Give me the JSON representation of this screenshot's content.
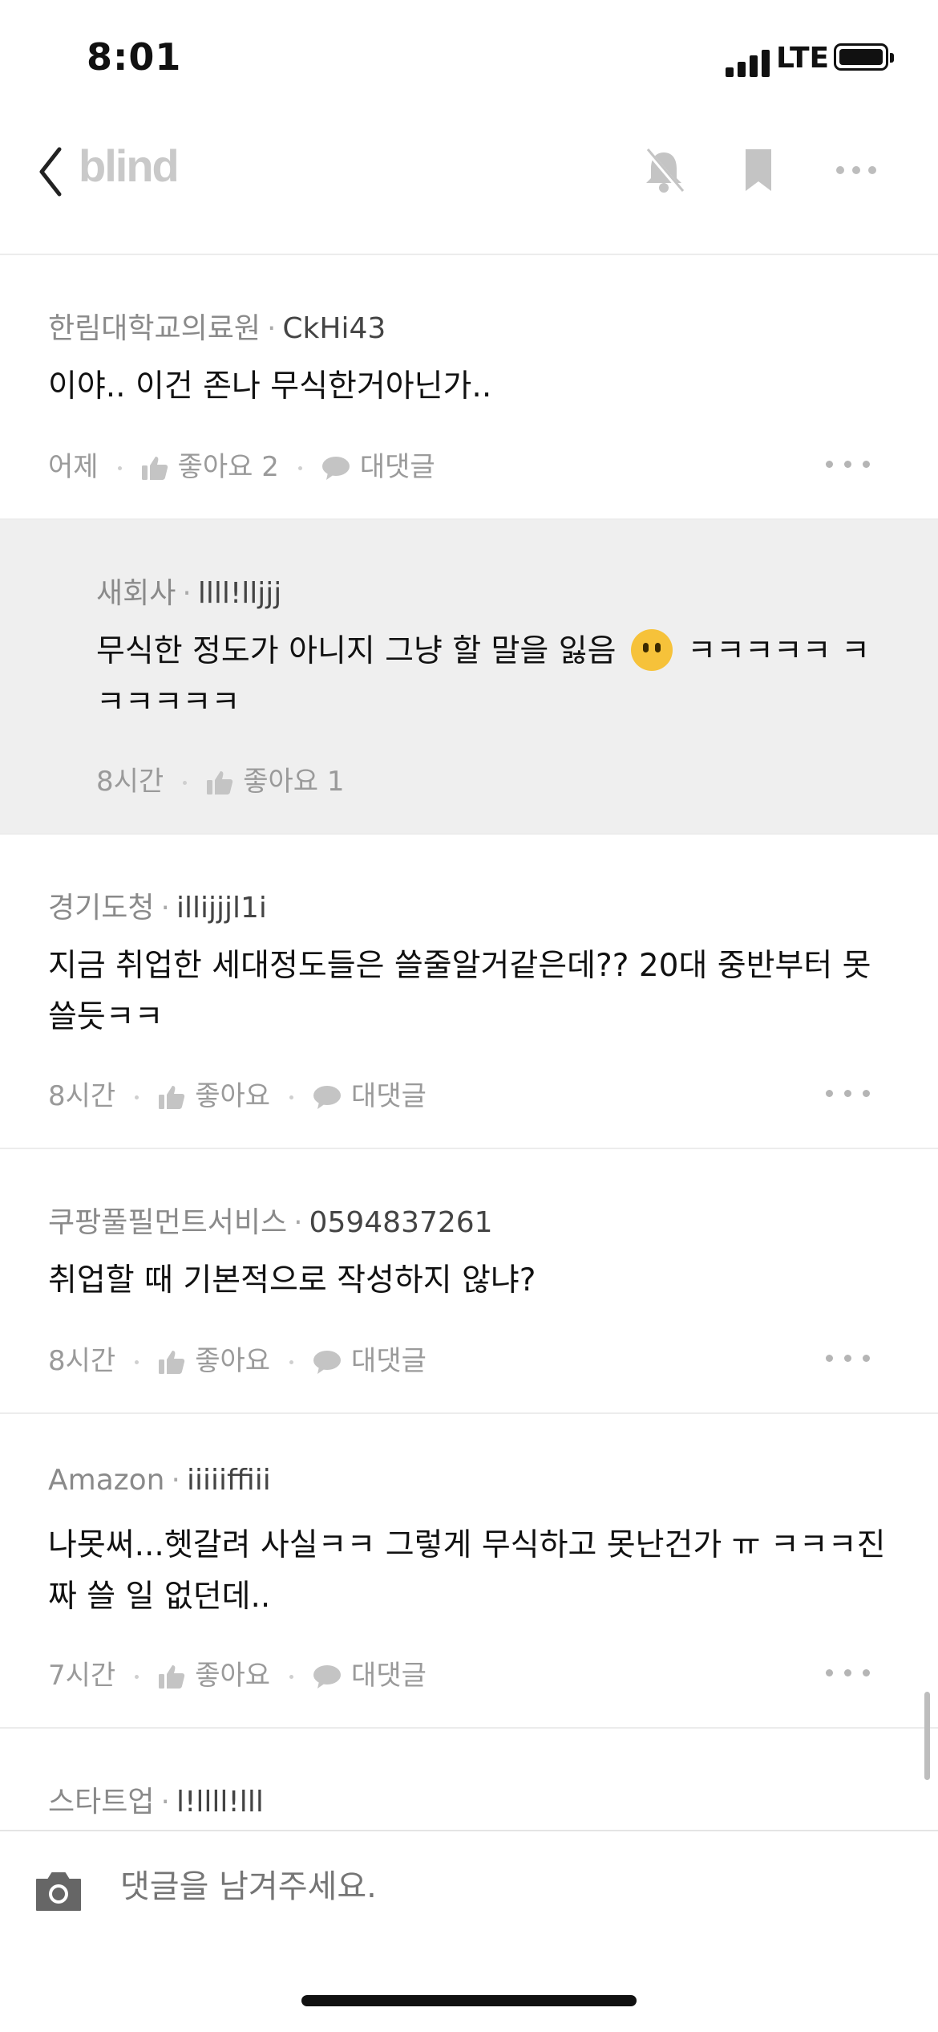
{
  "status_bar": {
    "time": "8:01",
    "network": "LTE"
  },
  "nav": {
    "brand": "blind",
    "icons": [
      "back-chevron-icon",
      "bell-off-icon",
      "bookmark-icon",
      "more-icon"
    ]
  },
  "comments": [
    {
      "company": "한림대학교의료원",
      "nickname": "CkHi43",
      "text": "이야.. 이건 존나 무식한거아닌가..",
      "time": "어제",
      "like_label": "좋아요 2",
      "reply_label": "대댓글"
    },
    {
      "company": "새회사",
      "nickname": "llll!lljjj",
      "text_before": "무식한 정도가 아니지 그냥 할 말을 잃음",
      "emoji": "face-without-mouth-emoji",
      "text_after": "ㅋㅋㅋㅋㅋ ㅋㅋㅋㅋㅋㅋ",
      "time": "8시간",
      "like_label": "좋아요 1"
    },
    {
      "company": "경기도청",
      "nickname": "illijjjl1i",
      "text": "지금 취업한 세대정도들은 쓸줄알거같은데?? 20대 중반부터 못쓸듯ㅋㅋ",
      "time": "8시간",
      "like_label": "좋아요",
      "reply_label": "대댓글"
    },
    {
      "company": "쿠팡풀필먼트서비스",
      "nickname": "0594837261",
      "text": "취업할 때 기본적으로 작성하지 않냐?",
      "time": "8시간",
      "like_label": "좋아요",
      "reply_label": "대댓글"
    },
    {
      "company": "Amazon",
      "nickname": "iiiiiffiii",
      "text": "나못써...헷갈려 사실ㅋㅋ 그렇게 무식하고 못난건가 ㅠ ㅋㅋㅋ진짜 쓸 일 없던데..",
      "time": "7시간",
      "like_label": "좋아요",
      "reply_label": "대댓글"
    },
    {
      "company": "스타트업",
      "nickname": "l!llll!lll"
    }
  ],
  "input": {
    "placeholder": "댓글을 남겨주세요."
  },
  "colors": {
    "meta_text": "#9a9a9a",
    "reply_background": "#efefef",
    "brand_text": "#c9c9c9"
  }
}
